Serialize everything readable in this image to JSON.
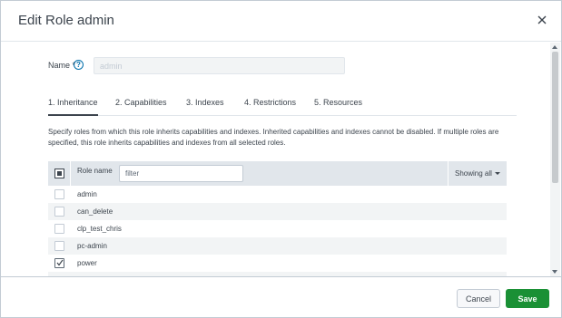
{
  "modal": {
    "title": "Edit Role admin",
    "close_icon": "close-icon"
  },
  "name_field": {
    "label": "Name *",
    "help_icon": "question-circle-icon",
    "help_glyph": "?",
    "value": "admin"
  },
  "tabs": [
    {
      "label": "1. Inheritance",
      "active": true
    },
    {
      "label": "2. Capabilities",
      "active": false
    },
    {
      "label": "3. Indexes",
      "active": false
    },
    {
      "label": "4. Restrictions",
      "active": false
    },
    {
      "label": "5. Resources",
      "active": false
    }
  ],
  "description": "Specify roles from which this role inherits capabilities and indexes. Inherited capabilities and indexes cannot be disabled. If multiple roles are specified, this role inherits capabilities and indexes from all selected roles.",
  "table": {
    "header_label": "Role name",
    "filter_placeholder": "filter",
    "showing_label": "Showing all",
    "rows": [
      {
        "name": "admin",
        "checked": false
      },
      {
        "name": "can_delete",
        "checked": false
      },
      {
        "name": "clp_test_chris",
        "checked": false
      },
      {
        "name": "pc-admin",
        "checked": false
      },
      {
        "name": "power",
        "checked": true
      }
    ]
  },
  "footer": {
    "cancel_label": "Cancel",
    "save_label": "Save"
  },
  "colors": {
    "save": "#1a9035",
    "header_bg": "#e1e6eb",
    "help": "#006eaa"
  }
}
